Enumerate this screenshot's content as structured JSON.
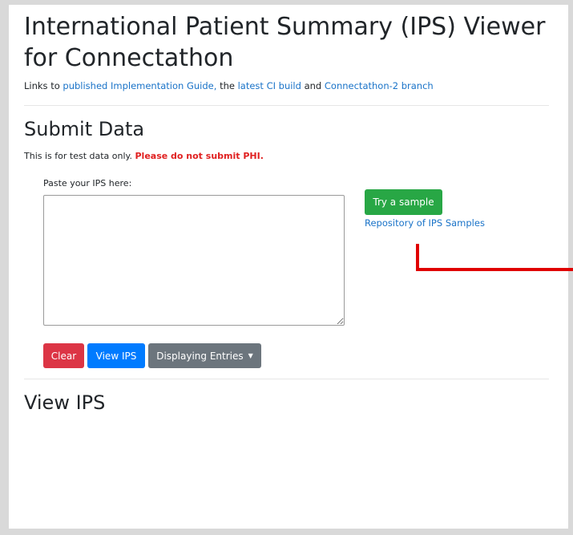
{
  "header": {
    "title_line1": "International Patient Summary (IPS) Viewer",
    "title_line2": "for Connectathon",
    "links_prefix": "Links to",
    "link_ig": "published Implementation Guide,",
    "links_mid": "the",
    "link_ci": "latest CI build",
    "links_and": "and",
    "link_branch": "Connectathon-2 branch"
  },
  "submit": {
    "heading": "Submit Data",
    "notice_text": "This is for test data only.",
    "notice_warning": "Please do not submit PHI.",
    "paste_label": "Paste your IPS here:",
    "textarea_value": "",
    "sample_button": "Try a sample",
    "repo_link": "Repository of IPS Samples",
    "clear_button": "Clear",
    "view_button": "View IPS",
    "display_button": "Displaying Entries",
    "display_caret": "▼"
  },
  "view": {
    "heading": "View IPS"
  },
  "colors": {
    "success": "#28a745",
    "danger": "#dc3545",
    "primary": "#007bff",
    "secondary": "#6c757d",
    "link": "#1a73c8",
    "annotation": "#e00000"
  }
}
